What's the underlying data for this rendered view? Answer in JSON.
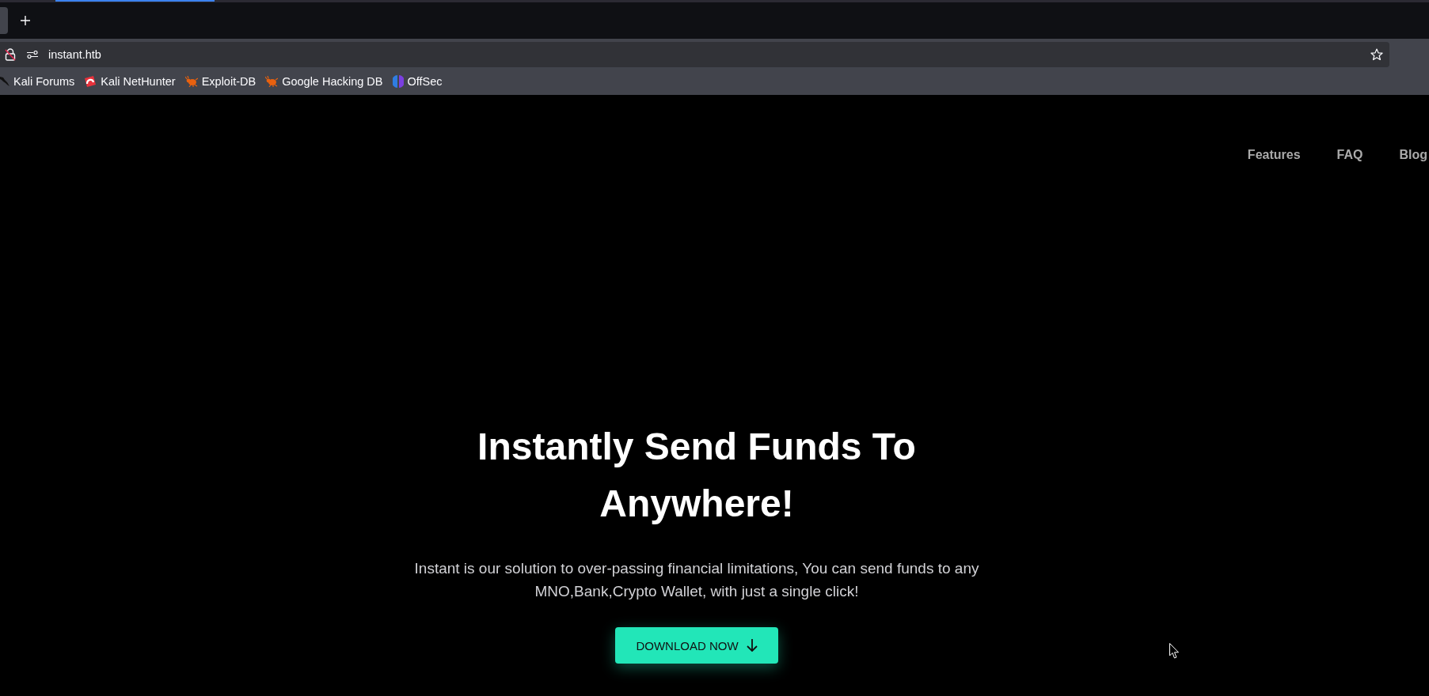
{
  "toolbar": {
    "url": "instant.htb"
  },
  "bookmarks": [
    {
      "label": "Kali Forums",
      "kind": "dragon"
    },
    {
      "label": "Kali NetHunter",
      "kind": "nethunter"
    },
    {
      "label": "Exploit-DB",
      "kind": "bug"
    },
    {
      "label": "Google Hacking DB",
      "kind": "bug"
    },
    {
      "label": "OffSec",
      "kind": "offsec"
    }
  ],
  "nav": {
    "links": [
      "Features",
      "FAQ",
      "Blog"
    ]
  },
  "hero": {
    "title": "Instantly Send Funds To Anywhere!",
    "description": "Instant is our solution to over-passing financial limitations, You can send funds to any MNO,Bank,Crypto Wallet, with just a single click!",
    "button": "DOWNLOAD NOW"
  }
}
